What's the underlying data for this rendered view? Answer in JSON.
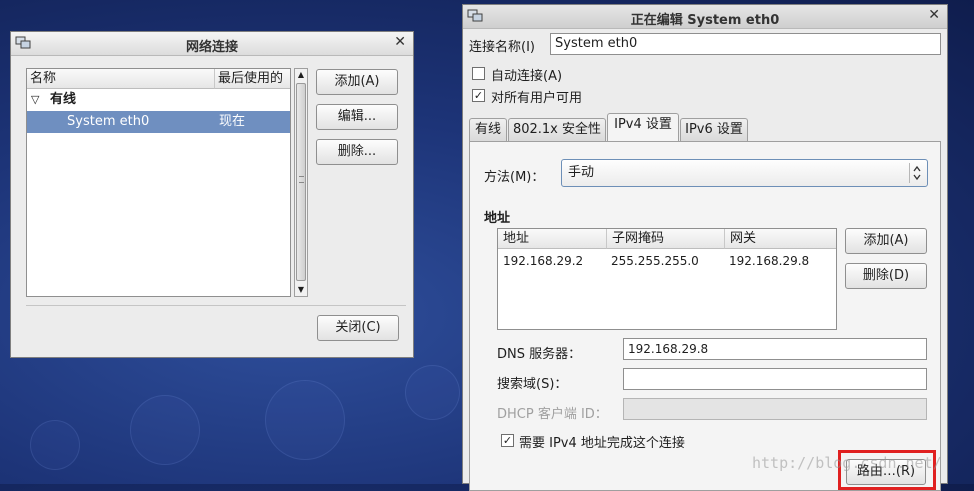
{
  "conn_window": {
    "title": "网络连接",
    "list": {
      "columns": [
        "名称",
        "最后使用的"
      ],
      "group_label": "有线",
      "rows": [
        {
          "name": "System eth0",
          "last_used": "现在"
        }
      ]
    },
    "buttons": {
      "add": "添加(A)",
      "edit": "编辑...",
      "delete": "删除...",
      "close": "关闭(C)"
    }
  },
  "edit_window": {
    "title": "正在编辑 System eth0",
    "conn_name_label": "连接名称(I)",
    "conn_name_value": "System eth0",
    "auto_connect_label": "自动连接(A)",
    "auto_connect_checked": false,
    "all_users_label": "对所有用户可用",
    "all_users_checked": true,
    "tabs": [
      "有线",
      "802.1x 安全性",
      "IPv4 设置",
      "IPv6 设置"
    ],
    "active_tab": "IPv4 设置",
    "method_label": "方法(M)：",
    "method_value": "手动",
    "address_section_label": "地址",
    "address_columns": [
      "地址",
      "子网掩码",
      "网关"
    ],
    "addresses": [
      {
        "address": "192.168.29.2",
        "netmask": "255.255.255.0",
        "gateway": "192.168.29.8"
      }
    ],
    "address_add": "添加(A)",
    "address_delete": "删除(D)",
    "dns_label": "DNS 服务器：",
    "dns_value": "192.168.29.8",
    "search_label": "搜索域(S)：",
    "search_value": "",
    "dhcp_label": "DHCP 客户端 ID：",
    "dhcp_value": "",
    "require_ipv4_label": "需要 IPv4 地址完成这个连接",
    "require_ipv4_checked": true,
    "routes_button": "路由…(R)",
    "highlight_color": "#e02020"
  },
  "watermark": "http://blog.csdn.net/"
}
